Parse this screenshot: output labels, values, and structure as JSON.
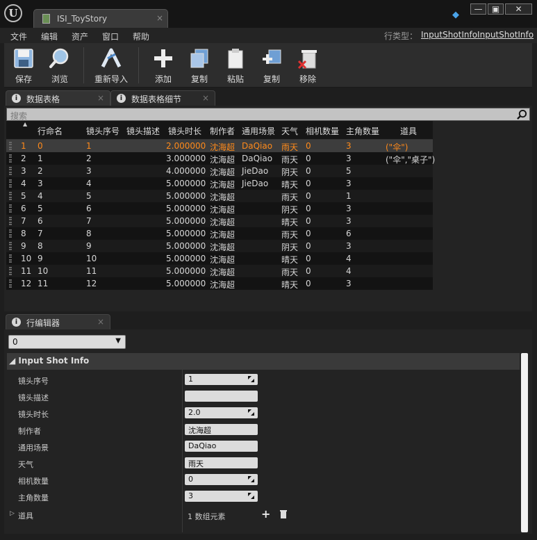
{
  "window": {
    "tab_title": "ISI_ToyStory",
    "tab_close": "×",
    "minimize": "—",
    "maximize": "▣",
    "close": "✕"
  },
  "menu": [
    "文件",
    "编辑",
    "资产",
    "窗口",
    "帮助"
  ],
  "row_type": {
    "label": "行类型：",
    "value": "InputShotInfoInputShotInfo"
  },
  "toolbar": {
    "save": "保存",
    "browse": "浏览",
    "reimport": "重新导入",
    "add": "添加",
    "copy": "复制",
    "paste": "粘贴",
    "duplicate": "复制",
    "remove": "移除"
  },
  "panels": {
    "data_table": "数据表格",
    "data_table_details": "数据表格细节",
    "row_editor": "行编辑器"
  },
  "search": {
    "placeholder": "搜索"
  },
  "table": {
    "columns": [
      "行命名",
      "镜头序号",
      "镜头描述",
      "镜头时长",
      "制作者",
      "通用场景",
      "天气",
      "相机数量",
      "主角数量",
      "道具"
    ],
    "rows": [
      {
        "idx": "1",
        "name": "0",
        "seq": "1",
        "desc": "",
        "dur": "2.000000",
        "author": "沈海超",
        "scene": "DaQiao",
        "weather": "雨天",
        "cams": "0",
        "actors": "3",
        "props": "(\"伞\")",
        "selected": true
      },
      {
        "idx": "2",
        "name": "1",
        "seq": "2",
        "desc": "",
        "dur": "3.000000",
        "author": "沈海超",
        "scene": "DaQiao",
        "weather": "雨天",
        "cams": "0",
        "actors": "3",
        "props": "(\"伞\",\"桌子\")"
      },
      {
        "idx": "3",
        "name": "2",
        "seq": "3",
        "desc": "",
        "dur": "4.000000",
        "author": "沈海超",
        "scene": "JieDao",
        "weather": "阴天",
        "cams": "0",
        "actors": "5",
        "props": ""
      },
      {
        "idx": "4",
        "name": "3",
        "seq": "4",
        "desc": "",
        "dur": "5.000000",
        "author": "沈海超",
        "scene": "JieDao",
        "weather": "晴天",
        "cams": "0",
        "actors": "3",
        "props": ""
      },
      {
        "idx": "5",
        "name": "4",
        "seq": "5",
        "desc": "",
        "dur": "5.000000",
        "author": "沈海超",
        "scene": "",
        "weather": "雨天",
        "cams": "0",
        "actors": "1",
        "props": ""
      },
      {
        "idx": "6",
        "name": "5",
        "seq": "6",
        "desc": "",
        "dur": "5.000000",
        "author": "沈海超",
        "scene": "",
        "weather": "阴天",
        "cams": "0",
        "actors": "3",
        "props": ""
      },
      {
        "idx": "7",
        "name": "6",
        "seq": "7",
        "desc": "",
        "dur": "5.000000",
        "author": "沈海超",
        "scene": "",
        "weather": "晴天",
        "cams": "0",
        "actors": "3",
        "props": ""
      },
      {
        "idx": "8",
        "name": "7",
        "seq": "8",
        "desc": "",
        "dur": "5.000000",
        "author": "沈海超",
        "scene": "",
        "weather": "雨天",
        "cams": "0",
        "actors": "6",
        "props": ""
      },
      {
        "idx": "9",
        "name": "8",
        "seq": "9",
        "desc": "",
        "dur": "5.000000",
        "author": "沈海超",
        "scene": "",
        "weather": "阴天",
        "cams": "0",
        "actors": "3",
        "props": ""
      },
      {
        "idx": "10",
        "name": "9",
        "seq": "10",
        "desc": "",
        "dur": "5.000000",
        "author": "沈海超",
        "scene": "",
        "weather": "晴天",
        "cams": "0",
        "actors": "4",
        "props": ""
      },
      {
        "idx": "11",
        "name": "10",
        "seq": "11",
        "desc": "",
        "dur": "5.000000",
        "author": "沈海超",
        "scene": "",
        "weather": "雨天",
        "cams": "0",
        "actors": "4",
        "props": ""
      },
      {
        "idx": "12",
        "name": "11",
        "seq": "12",
        "desc": "",
        "dur": "5.000000",
        "author": "沈海超",
        "scene": "",
        "weather": "晴天",
        "cams": "0",
        "actors": "3",
        "props": ""
      }
    ]
  },
  "row_editor": {
    "selected_row": "0",
    "category": "Input Shot Info",
    "fields": [
      {
        "label": "镜头序号",
        "value": "1",
        "spin": true
      },
      {
        "label": "镜头描述",
        "value": "",
        "spin": false
      },
      {
        "label": "镜头时长",
        "value": "2.0",
        "spin": true
      },
      {
        "label": "制作者",
        "value": "沈海超",
        "spin": false
      },
      {
        "label": "通用场景",
        "value": "DaQiao",
        "spin": false
      },
      {
        "label": "天气",
        "value": "雨天",
        "spin": false
      },
      {
        "label": "相机数量",
        "value": "0",
        "spin": true
      },
      {
        "label": "主角数量",
        "value": "3",
        "spin": true
      }
    ],
    "array_field": {
      "label": "道具",
      "value": "1 数组元素"
    }
  },
  "colors": {
    "accent": "#ff8a1a",
    "selected_row": "#3d3d3d",
    "background": "#1e1e1e"
  }
}
